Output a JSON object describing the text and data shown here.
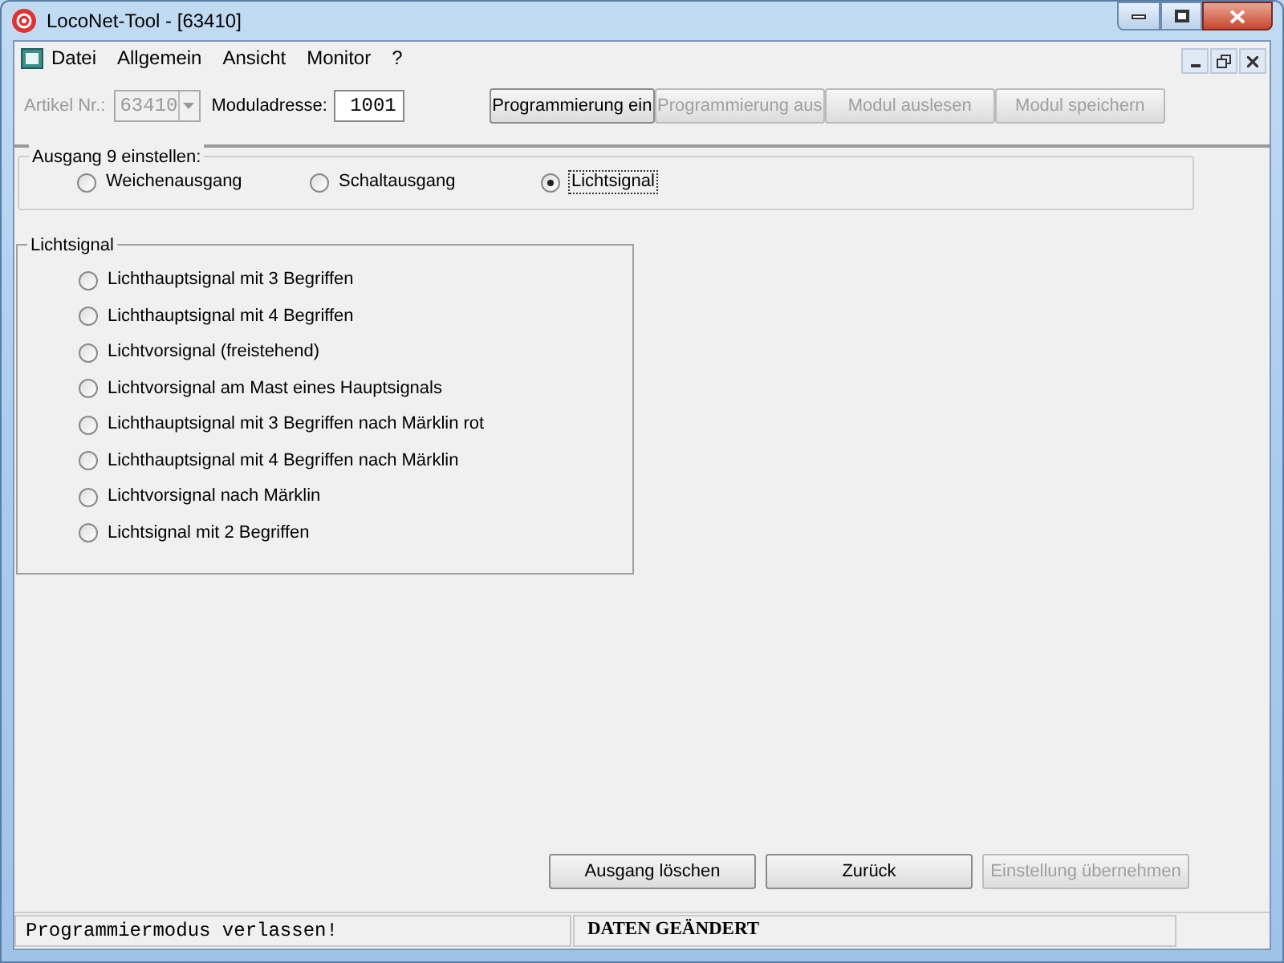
{
  "window": {
    "title": "LocoNet-Tool - [63410]"
  },
  "menu": [
    "Datei",
    "Allgemein",
    "Ansicht",
    "Monitor",
    "?"
  ],
  "toolbar": {
    "article_label": "Artikel Nr.:",
    "article_value": "63410",
    "article_disabled": true,
    "address_label": "Moduladresse:",
    "address_value": "1001",
    "buttons": [
      {
        "label": "Programmierung ein",
        "disabled": false
      },
      {
        "label": "Programmierung aus",
        "disabled": true
      },
      {
        "label": "Modul auslesen",
        "disabled": true
      },
      {
        "label": "Modul speichern",
        "disabled": true
      }
    ]
  },
  "output_group": {
    "title": "Ausgang 9 einstellen:",
    "options": [
      {
        "label": "Weichenausgang",
        "selected": false
      },
      {
        "label": "Schaltausgang",
        "selected": false
      },
      {
        "label": "Lichtsignal",
        "selected": true
      }
    ]
  },
  "signal_group": {
    "title": "Lichtsignal",
    "options": [
      {
        "label": "Lichthauptsignal mit 3 Begriffen",
        "selected": false
      },
      {
        "label": "Lichthauptsignal mit 4 Begriffen",
        "selected": false
      },
      {
        "label": "Lichtvorsignal (freistehend)",
        "selected": false
      },
      {
        "label": "Lichtvorsignal am Mast eines Hauptsignals",
        "selected": false
      },
      {
        "label": "Lichthauptsignal mit 3 Begriffen nach Märklin rot",
        "selected": false
      },
      {
        "label": "Lichthauptsignal mit 4 Begriffen nach Märklin",
        "selected": false
      },
      {
        "label": "Lichtvorsignal nach Märklin",
        "selected": false
      },
      {
        "label": "Lichtsignal mit 2 Begriffen",
        "selected": false
      }
    ]
  },
  "bottom_buttons": [
    {
      "label": "Ausgang löschen",
      "disabled": false
    },
    {
      "label": "Zurück",
      "disabled": false
    },
    {
      "label": "Einstellung übernehmen",
      "disabled": true
    }
  ],
  "status_bar": [
    "Programmiermodus verlassen!",
    "DATEN GEÄNDERT"
  ]
}
